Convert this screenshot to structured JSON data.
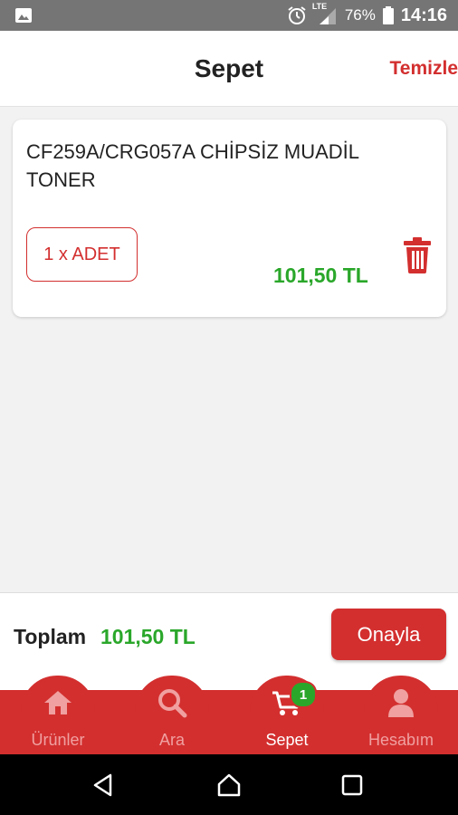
{
  "status_bar": {
    "network": "LTE",
    "battery": "76%",
    "time": "14:16"
  },
  "header": {
    "title": "Sepet",
    "clear_label": "Temizle"
  },
  "cart": {
    "items": [
      {
        "name": "CF259A/CRG057A CHİPSİZ MUADİL TONER",
        "quantity_label": "1 x ADET",
        "price": "101,50 TL"
      }
    ]
  },
  "summary": {
    "total_label": "Toplam",
    "total_value": "101,50 TL",
    "confirm_label": "Onayla"
  },
  "tabs": [
    {
      "label": "Ürünler",
      "icon": "home-icon"
    },
    {
      "label": "Ara",
      "icon": "search-icon"
    },
    {
      "label": "Sepet",
      "icon": "cart-icon",
      "badge": "1",
      "active": true
    },
    {
      "label": "Hesabım",
      "icon": "user-icon"
    }
  ],
  "colors": {
    "accent": "#d32f2f",
    "price": "#2aa72a",
    "statusbar": "#757575"
  }
}
